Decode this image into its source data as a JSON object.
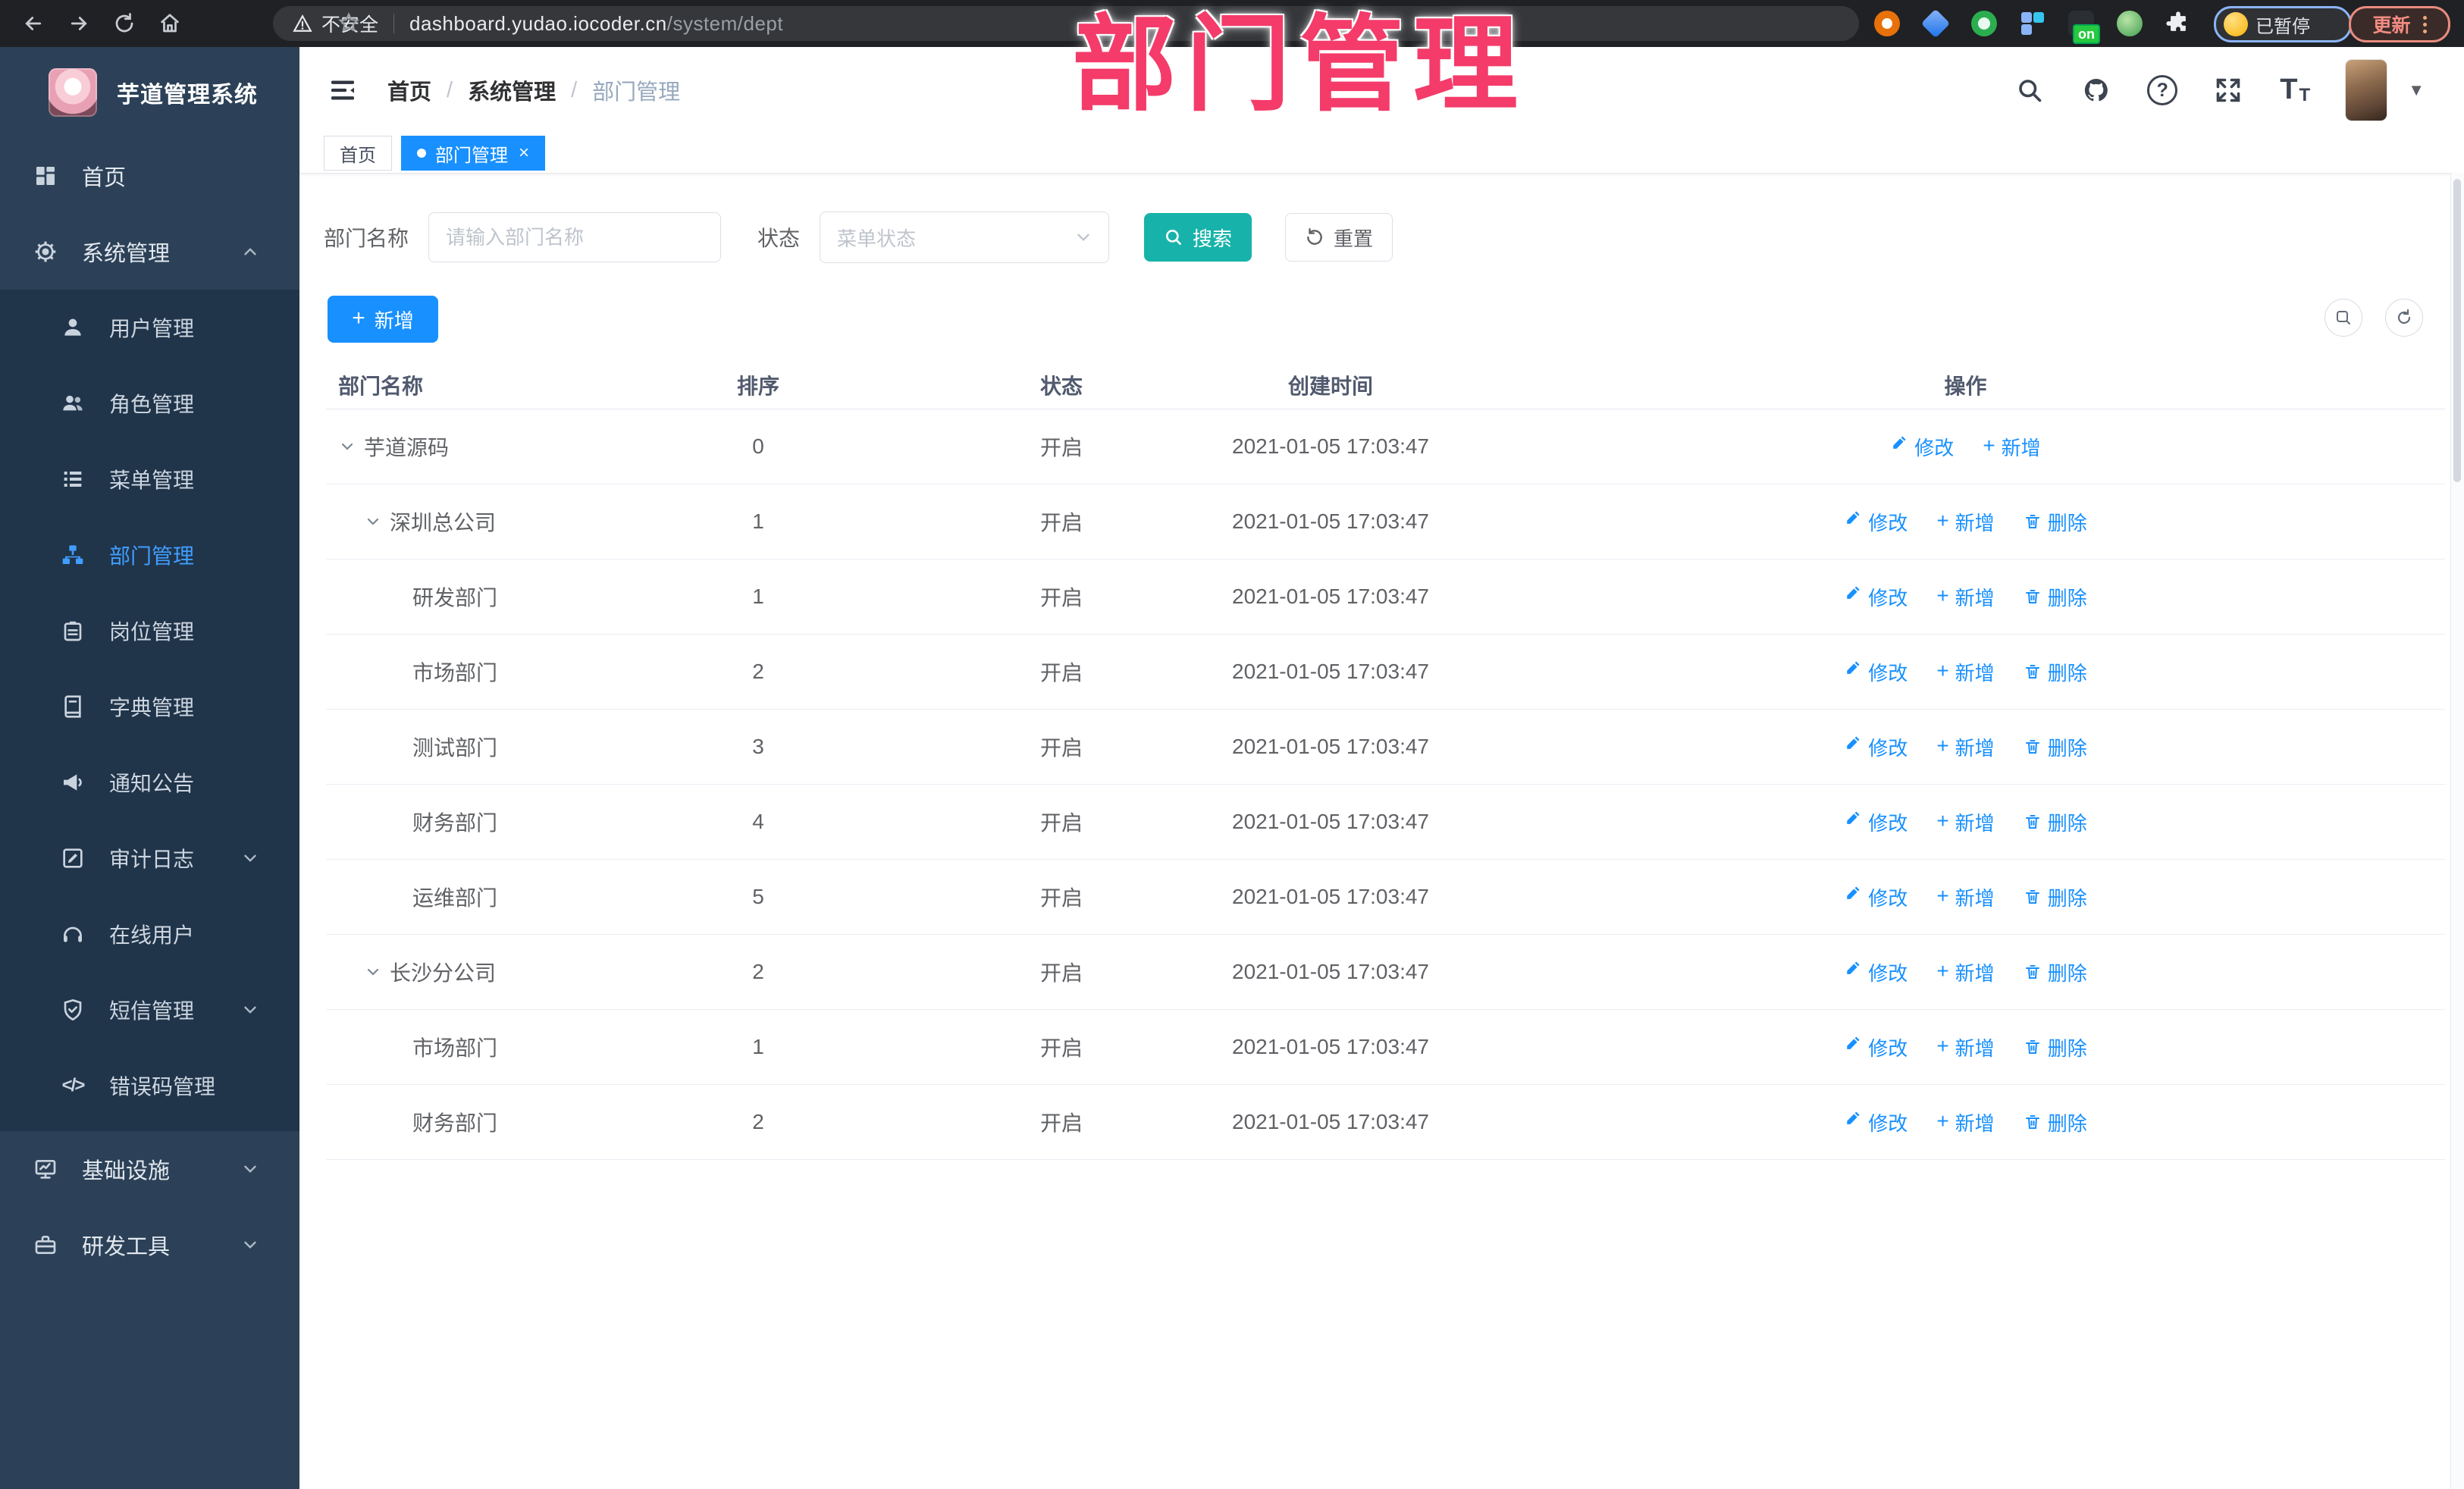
{
  "watermark_label": "部门管理",
  "browser": {
    "security_label": "不安全",
    "url_host": "dashboard.yudao.iocoder.cn",
    "url_path": "/system/dept",
    "profile_status_label": "已暂停",
    "update_label": "更新",
    "extension_badge": "on"
  },
  "sidebar": {
    "title": "芋道管理系统",
    "items": [
      {
        "label": "首页",
        "icon": "dashboard",
        "type": "root"
      },
      {
        "label": "系统管理",
        "icon": "gear",
        "type": "root",
        "expanded": true
      },
      {
        "label": "用户管理",
        "icon": "user",
        "type": "sub"
      },
      {
        "label": "角色管理",
        "icon": "users",
        "type": "sub"
      },
      {
        "label": "菜单管理",
        "icon": "menu",
        "type": "sub"
      },
      {
        "label": "部门管理",
        "icon": "sitemap",
        "type": "sub",
        "active": true
      },
      {
        "label": "岗位管理",
        "icon": "badge",
        "type": "sub"
      },
      {
        "label": "字典管理",
        "icon": "dict",
        "type": "sub"
      },
      {
        "label": "通知公告",
        "icon": "announce",
        "type": "sub"
      },
      {
        "label": "审计日志",
        "icon": "audit",
        "type": "sub",
        "collapsible": true
      },
      {
        "label": "在线用户",
        "icon": "online",
        "type": "sub"
      },
      {
        "label": "短信管理",
        "icon": "sms",
        "type": "sub",
        "collapsible": true
      },
      {
        "label": "错误码管理",
        "icon": "code",
        "type": "sub"
      },
      {
        "label": "基础设施",
        "icon": "infra",
        "type": "root",
        "collapsible": true
      },
      {
        "label": "研发工具",
        "icon": "tools",
        "type": "root",
        "collapsible": true
      }
    ]
  },
  "header": {
    "breadcrumb": [
      "首页",
      "系统管理",
      "部门管理"
    ],
    "separator": "/",
    "font_icon_letter": "T"
  },
  "tabs": [
    {
      "label": "首页",
      "active": false,
      "closable": false
    },
    {
      "label": "部门管理",
      "active": true,
      "closable": true
    }
  ],
  "filters": {
    "name_label": "部门名称",
    "name_placeholder": "请输入部门名称",
    "status_label": "状态",
    "status_placeholder": "菜单状态",
    "search_label": "搜索",
    "reset_label": "重置"
  },
  "toolbar": {
    "add_label": "新增"
  },
  "table": {
    "columns": [
      "部门名称",
      "排序",
      "状态",
      "创建时间",
      "操作"
    ],
    "actions": {
      "edit": "修改",
      "add": "新增",
      "delete": "删除"
    },
    "rows": [
      {
        "name": "芋道源码",
        "level": 0,
        "expandable": true,
        "sort": "0",
        "status": "开启",
        "time": "2021-01-05 17:03:47",
        "deletable": false
      },
      {
        "name": "深圳总公司",
        "level": 1,
        "expandable": true,
        "sort": "1",
        "status": "开启",
        "time": "2021-01-05 17:03:47",
        "deletable": true
      },
      {
        "name": "研发部门",
        "level": 2,
        "expandable": false,
        "sort": "1",
        "status": "开启",
        "time": "2021-01-05 17:03:47",
        "deletable": true
      },
      {
        "name": "市场部门",
        "level": 2,
        "expandable": false,
        "sort": "2",
        "status": "开启",
        "time": "2021-01-05 17:03:47",
        "deletable": true
      },
      {
        "name": "测试部门",
        "level": 2,
        "expandable": false,
        "sort": "3",
        "status": "开启",
        "time": "2021-01-05 17:03:47",
        "deletable": true
      },
      {
        "name": "财务部门",
        "level": 2,
        "expandable": false,
        "sort": "4",
        "status": "开启",
        "time": "2021-01-05 17:03:47",
        "deletable": true
      },
      {
        "name": "运维部门",
        "level": 2,
        "expandable": false,
        "sort": "5",
        "status": "开启",
        "time": "2021-01-05 17:03:47",
        "deletable": true
      },
      {
        "name": "长沙分公司",
        "level": 1,
        "expandable": true,
        "sort": "2",
        "status": "开启",
        "time": "2021-01-05 17:03:47",
        "deletable": true
      },
      {
        "name": "市场部门",
        "level": 2,
        "expandable": false,
        "sort": "1",
        "status": "开启",
        "time": "2021-01-05 17:03:47",
        "deletable": true
      },
      {
        "name": "财务部门",
        "level": 2,
        "expandable": false,
        "sort": "2",
        "status": "开启",
        "time": "2021-01-05 17:03:47",
        "deletable": true
      }
    ]
  },
  "colors": {
    "accent_blue": "#1890ff",
    "active_menu_blue": "#409eff",
    "search_teal": "#17b3aa",
    "watermark_pink": "#f43b69",
    "sidebar_bg": "#2c4157",
    "submenu_bg": "#20344a",
    "browser_bg": "#202124"
  }
}
